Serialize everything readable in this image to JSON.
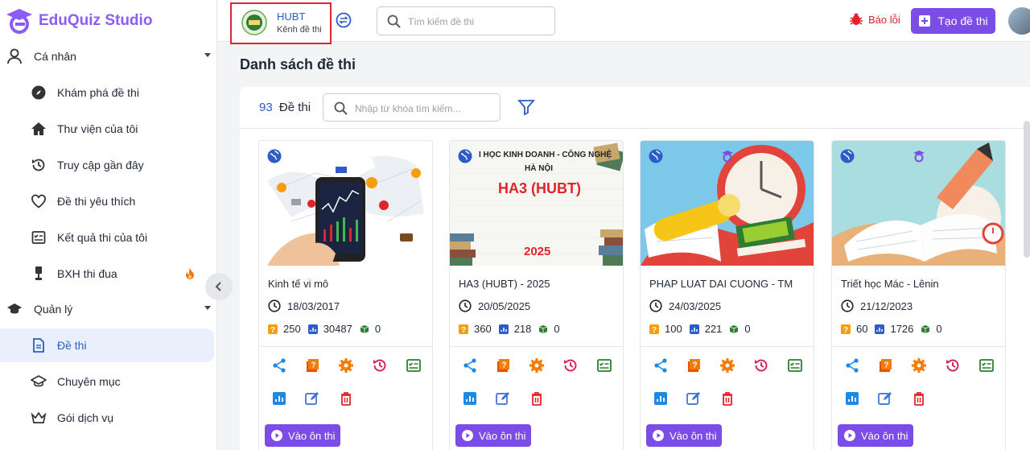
{
  "app": {
    "title": "EduQuiz Studio"
  },
  "sidebar": {
    "personal": {
      "label": "Cá nhân"
    },
    "personal_items": [
      {
        "label": "Khám phá đề thi",
        "icon": "compass-icon"
      },
      {
        "label": "Thư viện của tôi",
        "icon": "home-icon"
      },
      {
        "label": "Truy cập gần đây",
        "icon": "history-icon"
      },
      {
        "label": "Đề thi yêu thích",
        "icon": "heart-icon"
      },
      {
        "label": "Kết quả thi của tôi",
        "icon": "result-icon"
      },
      {
        "label": "BXH thi đua",
        "icon": "trophy-icon"
      }
    ],
    "manage": {
      "label": "Quản lý"
    },
    "manage_items": [
      {
        "label": "Đề thi",
        "icon": "document-icon",
        "active": true
      },
      {
        "label": "Chuyên mục",
        "icon": "graduation-cap-icon"
      },
      {
        "label": "Gói dịch vụ",
        "icon": "crown-icon"
      }
    ]
  },
  "header": {
    "channel": {
      "name": "HUBT",
      "subtitle": "Kênh đề thi"
    },
    "search_placeholder": "Tìm kiếm đề thi",
    "report_label": "Báo lỗi",
    "create_label": "Tạo đề thi"
  },
  "main": {
    "title": "Danh sách đề thi",
    "count": "93",
    "count_label": "Đề thi",
    "search_placeholder": "Nhập từ khóa tìm kiếm..."
  },
  "cards": [
    {
      "title": "Kinh tế vi mô",
      "date": "18/03/2017",
      "questions": "250",
      "views": "30487",
      "downloads": "0",
      "button": "Vào ôn thi"
    },
    {
      "title": "HA3 (HUBT) - 2025",
      "date": "20/05/2025",
      "questions": "360",
      "views": "218",
      "downloads": "0",
      "button": "Vào ôn thi",
      "thumb": {
        "line1": "I HỌC KINH DOANH - CÔNG NGHỆ",
        "line2": "HÀ NỘI",
        "main": "HA3 (HUBT)",
        "year": "2025"
      }
    },
    {
      "title": "PHAP LUAT DAI CUONG - TM",
      "date": "24/03/2025",
      "questions": "100",
      "views": "221",
      "downloads": "0",
      "button": "Vào ôn thi"
    },
    {
      "title": "Triết học Mác - Lênin",
      "date": "21/12/2023",
      "questions": "60",
      "views": "1726",
      "downloads": "0",
      "button": "Vào ôn thi"
    }
  ],
  "colors": {
    "accent": "#7c4ce6",
    "blue": "#2b5cc8",
    "red": "#e0242b",
    "orange": "#f59e0b",
    "green": "#2e7d32"
  }
}
